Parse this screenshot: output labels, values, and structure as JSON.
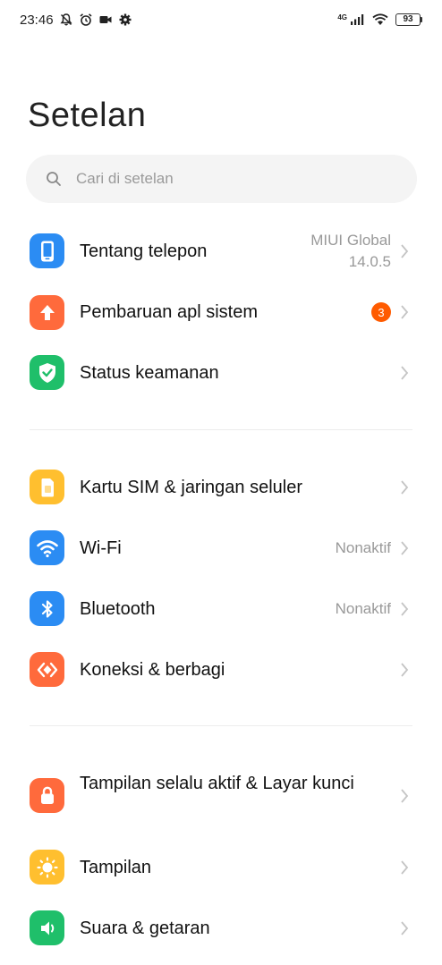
{
  "status_bar": {
    "time": "23:46",
    "network": "4G",
    "battery": "93"
  },
  "page_title": "Setelan",
  "search": {
    "placeholder": "Cari di setelan"
  },
  "items": [
    {
      "label": "Tentang telepon",
      "value_line1": "MIUI Global",
      "value_line2": "14.0.5",
      "icon": "phone-icon",
      "color": "#2b8cf3"
    },
    {
      "label": "Pembaruan apl sistem",
      "badge": "3",
      "icon": "arrow-up-icon",
      "color": "#ff6a3c"
    },
    {
      "label": "Status keamanan",
      "icon": "shield-check-icon",
      "color": "#1fbf6a"
    },
    {
      "label": "Kartu SIM & jaringan seluler",
      "icon": "sim-card-icon",
      "color": "#ffbf2f"
    },
    {
      "label": "Wi-Fi",
      "value": "Nonaktif",
      "icon": "wifi-icon",
      "color": "#2b8cf3"
    },
    {
      "label": "Bluetooth",
      "value": "Nonaktif",
      "icon": "bluetooth-icon",
      "color": "#2b8cf3"
    },
    {
      "label": "Koneksi & berbagi",
      "icon": "connection-sharing-icon",
      "color": "#ff6a3c"
    },
    {
      "label": "Tampilan selalu aktif & Layar kunci",
      "icon": "lock-icon",
      "color": "#ff6a3c"
    },
    {
      "label": "Tampilan",
      "icon": "sun-icon",
      "color": "#ffbf2f"
    },
    {
      "label": "Suara & getaran",
      "icon": "speaker-icon",
      "color": "#1fbf6a"
    }
  ]
}
